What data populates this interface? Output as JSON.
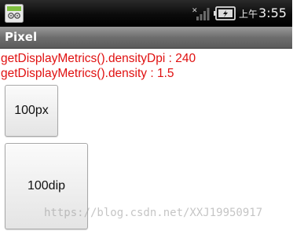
{
  "status_bar": {
    "notification_icon": "android-debug-icon",
    "signal_icon": "signal-strength-icon",
    "battery_icon": "battery-icon",
    "ampm": "上午",
    "time": "3:55"
  },
  "title_bar": {
    "title": "Pixel"
  },
  "metrics": {
    "density_dpi_line": "getDisplayMetrics().densityDpi : 240",
    "density_line": "getDisplayMetrics().density : 1.5"
  },
  "buttons": {
    "px_label": "100px",
    "dip_label": "100dip"
  },
  "watermark": {
    "text": "https://blog.csdn.net/XXJ19950917"
  },
  "colors": {
    "metric_text": "#e01010",
    "status_bar_bg": "#000000",
    "title_bar_bg": "#6e6e6e"
  }
}
